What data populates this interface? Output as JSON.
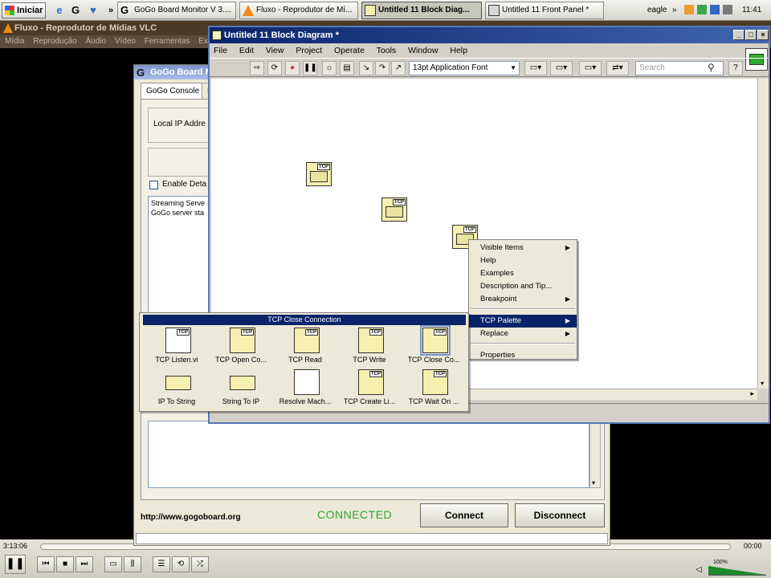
{
  "taskbar": {
    "start_label": "Iniciar",
    "quicklaunch_chevron": "»",
    "tasks": [
      {
        "label": "GoGo Board Monitor V 3....",
        "icon": "gogo-icon",
        "active": false
      },
      {
        "label": "Fluxo - Reprodutor de Mí...",
        "icon": "vlc-cone-icon",
        "active": false
      },
      {
        "label": "Untitled 11 Block Diag...",
        "icon": "labview-block-diagram-icon",
        "active": true
      },
      {
        "label": "Untitled 11 Front Panel *",
        "icon": "labview-front-panel-icon",
        "active": false
      }
    ],
    "tray_user": "eagle",
    "tray_chevron": "»",
    "clock": "11:41"
  },
  "vlc": {
    "title": "Fluxo - Reprodutor de Mídias VLC",
    "menu": [
      "Mídia",
      "Reprodução",
      "Áudio",
      "Vídeo",
      "Ferramentas",
      "Ex"
    ],
    "time_elapsed": "3:13:06",
    "time_total": "00:00",
    "volume": "100%",
    "progress": 0
  },
  "gogo": {
    "title": "GoGo Board M",
    "tabs": [
      "GoGo Console",
      "L"
    ],
    "local_ip_label": "Local IP Addre",
    "enable_label": "Enable Deta",
    "log_lines": [
      "Streaming Serve",
      "GoGo server sta"
    ],
    "url": "http://www.gogoboard.org",
    "status": "CONNECTED",
    "connect_label": "Connect",
    "disconnect_label": "Disconnect"
  },
  "labview": {
    "title": "Untitled 11 Block Diagram *",
    "menu": [
      "File",
      "Edit",
      "View",
      "Project",
      "Operate",
      "Tools",
      "Window",
      "Help"
    ],
    "font_dropdown": "13pt Application Font",
    "search_placeholder": "Search",
    "node_tag": "TCP"
  },
  "context_menu": {
    "items": [
      {
        "label": "Visible Items",
        "submenu": true
      },
      {
        "label": "Help",
        "submenu": false
      },
      {
        "label": "Examples",
        "submenu": false
      },
      {
        "label": "Description and Tip...",
        "submenu": false
      },
      {
        "label": "Breakpoint",
        "submenu": true
      },
      {
        "label": "TCP Palette",
        "submenu": true,
        "selected": true
      },
      {
        "label": "Replace",
        "submenu": true
      },
      {
        "label": "Properties",
        "submenu": false
      }
    ],
    "arrow": "▶"
  },
  "palette": {
    "title": "TCP Close Connection",
    "items": [
      "TCP Listen.vi",
      "TCP Open Co...",
      "TCP Read",
      "TCP Write",
      "TCP Close Co...",
      "IP To String",
      "String To IP",
      "Resolve Mach...",
      "TCP Create Li...",
      "TCP Wait On ..."
    ]
  }
}
